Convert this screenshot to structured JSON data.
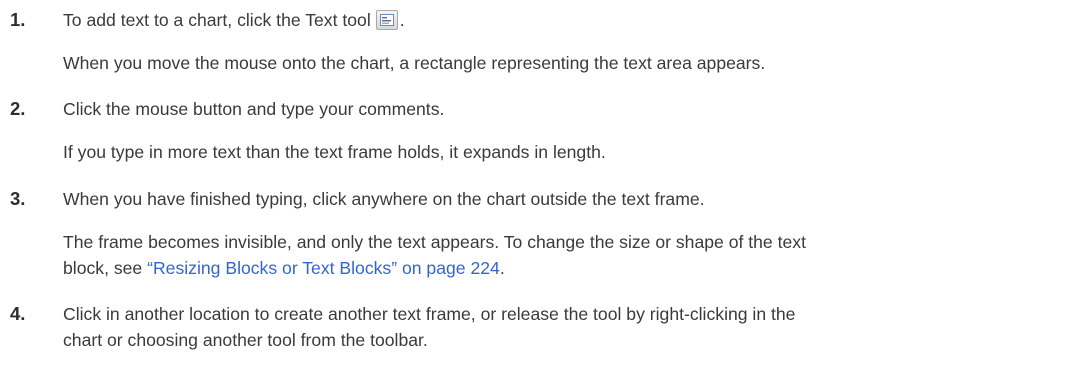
{
  "steps": [
    {
      "number": "1.",
      "instruction_before_icon": "To add text to a chart, click the Text tool",
      "instruction_after_icon": ".",
      "icon": "text-tool-icon",
      "note": "When you move the mouse onto the chart, a rectangle representing the text area appears."
    },
    {
      "number": "2.",
      "instruction": "Click the mouse button and type your comments.",
      "note": "If you type in more text than the text frame holds, it expands in length."
    },
    {
      "number": "3.",
      "instruction": "When you have finished typing, click anywhere on the chart outside the text frame.",
      "note_line1": "The frame becomes invisible, and only the text appears. To change the size or shape of the text",
      "note_line2_before_link": "block, see ",
      "note_link": "“Resizing Blocks or Text Blocks” on page 224",
      "note_line2_after_link": "."
    },
    {
      "number": "4.",
      "instruction_line1": "Click in another location to create another text frame, or release the tool by right-clicking in the",
      "instruction_line2": "chart or choosing another tool from the toolbar."
    }
  ],
  "colors": {
    "text": "#3a3a3a",
    "link": "#3366cc"
  }
}
